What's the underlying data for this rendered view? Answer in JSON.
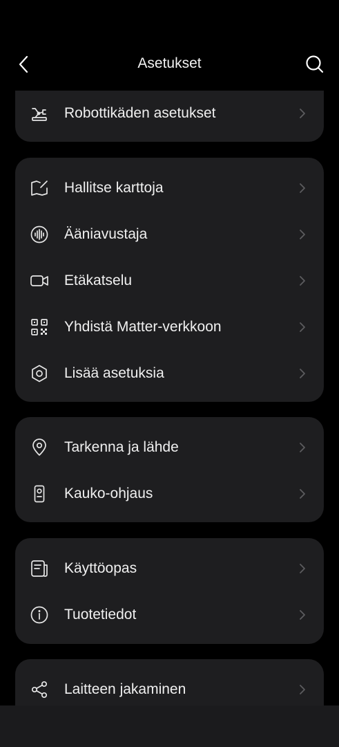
{
  "header": {
    "title": "Asetukset"
  },
  "icons": {
    "back": "chevron-left-icon",
    "search": "search-icon"
  },
  "colors": {
    "background": "#000000",
    "card": "#1e1e20",
    "text": "#f0f0f0",
    "chevron": "#5c5c5f"
  },
  "groups": [
    {
      "items": [
        {
          "label": "Robottikäden asetukset",
          "icon": "robot-arm-icon"
        }
      ]
    },
    {
      "items": [
        {
          "label": "Hallitse karttoja",
          "icon": "map-edit-icon"
        },
        {
          "label": "Ääniavustaja",
          "icon": "voice-wave-icon"
        },
        {
          "label": "Etäkatselu",
          "icon": "video-camera-icon"
        },
        {
          "label": "Yhdistä Matter-verkkoon",
          "icon": "qr-code-icon"
        },
        {
          "label": "Lisää asetuksia",
          "icon": "hexagon-settings-icon"
        }
      ]
    },
    {
      "items": [
        {
          "label": "Tarkenna ja lähde",
          "icon": "location-pin-icon"
        },
        {
          "label": "Kauko-ohjaus",
          "icon": "remote-control-icon"
        }
      ]
    },
    {
      "items": [
        {
          "label": "Käyttöopas",
          "icon": "manual-icon"
        },
        {
          "label": "Tuotetiedot",
          "icon": "info-icon"
        }
      ]
    },
    {
      "items": [
        {
          "label": "Laitteen jakaminen",
          "icon": "share-icon"
        }
      ]
    }
  ]
}
